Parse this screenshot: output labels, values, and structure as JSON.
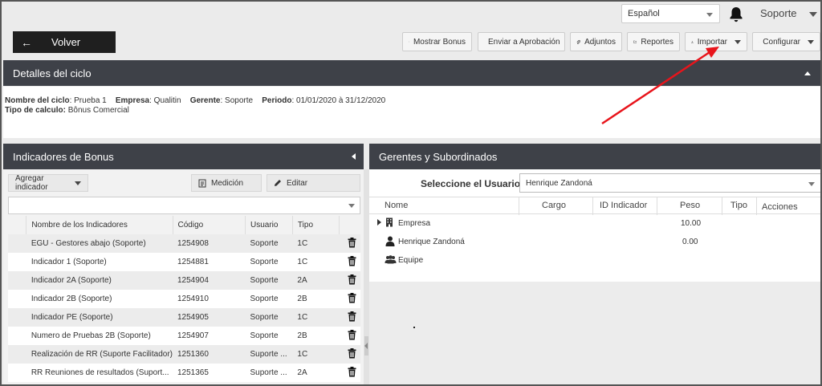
{
  "topbar": {
    "language": "Español",
    "user_name": "Soporte"
  },
  "toolbar": {
    "back_label": "Volver",
    "buttons": [
      {
        "label": "Mostrar Bonus",
        "icon": "eye-icon"
      },
      {
        "label": "Enviar a Aprobación",
        "icon": "share-icon"
      },
      {
        "label": "Adjuntos",
        "icon": "paperclip-icon"
      },
      {
        "label": "Reportes",
        "icon": "folder-icon"
      },
      {
        "label": "Importar",
        "icon": "upload-icon"
      },
      {
        "label": "Configurar",
        "icon": "gear-icon"
      }
    ]
  },
  "details": {
    "title": "Detalles del ciclo",
    "cycle_label": "Nombre del ciclo",
    "cycle_value": ": Prueba 1",
    "company_label": "Empresa",
    "company_value": ": Qualitin",
    "manager_label": "Gerente",
    "manager_value": ": Soporte",
    "period_label": "Periodo",
    "period_value": ": 01/01/2020 à 31/12/2020",
    "calc_label": "Tipo de calculo:",
    "calc_value": " Bônus Comercial"
  },
  "indicators": {
    "title": "Indicadores de Bonus",
    "add_label": "Agregar indicador",
    "measure_label": "Medición",
    "edit_label": "Editar",
    "columns": [
      "Nombre de los Indicadores",
      "Código",
      "Usuario",
      "Tipo"
    ],
    "rows": [
      {
        "name": "EGU - Gestores abajo (Soporte)",
        "code": "1254908",
        "user": "Soporte",
        "type": "1C"
      },
      {
        "name": "Indicador 1 (Soporte)",
        "code": "1254881",
        "user": "Soporte",
        "type": "1C"
      },
      {
        "name": "Indicador 2A (Soporte)",
        "code": "1254904",
        "user": "Soporte",
        "type": "2A"
      },
      {
        "name": "Indicador 2B (Soporte)",
        "code": "1254910",
        "user": "Soporte",
        "type": "2B"
      },
      {
        "name": "Indicador PE (Soporte)",
        "code": "1254905",
        "user": "Soporte",
        "type": "1C"
      },
      {
        "name": "Numero de Pruebas 2B (Soporte)",
        "code": "1254907",
        "user": "Soporte",
        "type": "2B"
      },
      {
        "name": "Realización de RR (Suporte Facilitador)",
        "code": "1251360",
        "user": "Suporte ...",
        "type": "1C"
      },
      {
        "name": "RR Reuniones de resultados (Suport...",
        "code": "1251365",
        "user": "Suporte ...",
        "type": "2A"
      }
    ]
  },
  "managers": {
    "title": "Gerentes y Subordinados",
    "select_label": "Seleccione el Usuario",
    "selected_user": "Henrique Zandoná",
    "columns": [
      "Nome",
      "Cargo",
      "ID Indicador",
      "Peso",
      "Tipo",
      "Acciones"
    ],
    "rows": [
      {
        "name": "Empresa",
        "peso": "10.00",
        "icon": "building-icon"
      },
      {
        "name": "Henrique Zandoná",
        "peso": "0.00",
        "icon": "user-icon"
      },
      {
        "name": "Equipe",
        "peso": "",
        "icon": "users-icon"
      }
    ]
  },
  "colors": {
    "header_dark": "#3e4148",
    "back_button": "#1f1f1f",
    "annotation_arrow": "#e8141b"
  }
}
